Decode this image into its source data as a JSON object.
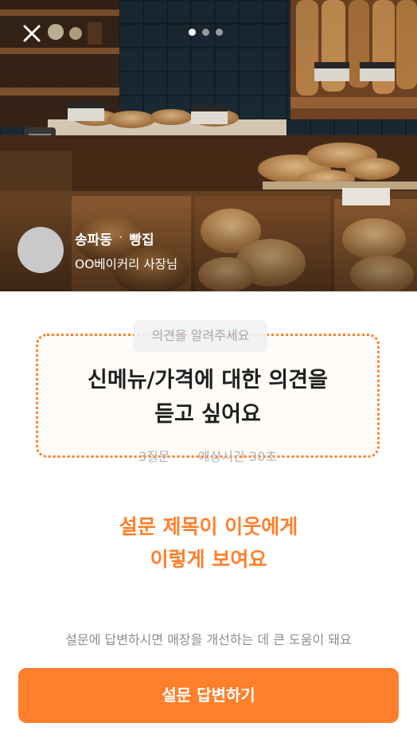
{
  "header": {
    "close_icon": "close-icon",
    "page_indicator": {
      "total": 3,
      "current": 1
    }
  },
  "shop": {
    "region": "송파동",
    "separator": "·",
    "category": "빵집",
    "owner": "OO베이커리 사장님"
  },
  "card": {
    "tag": "의견을 알려주세요",
    "title_line1": "신메뉴/가격에 대한 의견을",
    "title_line2": "듣고 싶어요",
    "question_count": "3질문",
    "meta_separator": "·",
    "estimated_time": "예상시간 30초"
  },
  "caption": {
    "line1": "설문 제목이 이웃에게",
    "line2": "이렇게 보여요"
  },
  "helper_text": "설문에 답변하시면 매장을 개선하는 데 큰 도움이 돼요",
  "cta_label": "설문 답변하기",
  "colors": {
    "accent": "#ff7f2a",
    "card_border": "#ff7f2a",
    "avatar": "#c9c9c9"
  }
}
